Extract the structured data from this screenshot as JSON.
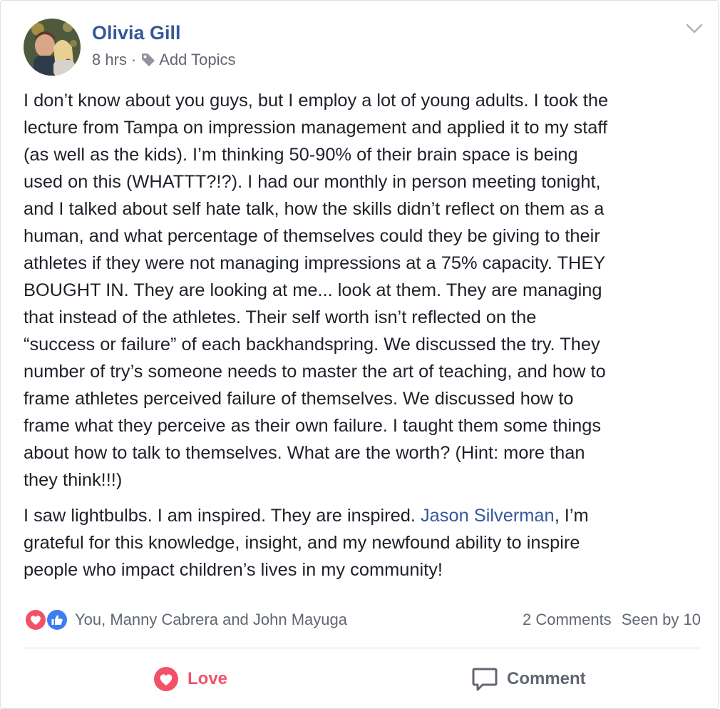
{
  "post": {
    "author": "Olivia Gill",
    "time": "8 hrs",
    "separator": "·",
    "add_topics": "Add Topics",
    "body_lines": [
      "I don’t know about you guys, but I employ a lot of young adults. I took the",
      "lecture from Tampa on impression management and applied it to my staff",
      "(as well as the kids). I’m thinking 50-90% of their brain space is being",
      "used on this (WHATTT?!?). I had our monthly in person meeting tonight,",
      "and I talked about self hate talk, how the skills didn’t reflect on them as a",
      "human, and what percentage of themselves could they be giving to their",
      "athletes if they were not managing impressions at a 75% capacity. THEY",
      "BOUGHT IN. They are looking at me... look at them. They are managing",
      "that instead of the athletes. Their self worth isn’t reflected on the",
      "“success or failure” of each backhandspring. We discussed the try. They",
      "number of try’s someone needs to master the art of teaching, and how to",
      "frame athletes perceived failure of themselves. We discussed how to",
      "frame what they perceive as their own failure. I taught them some things",
      "about how to talk to themselves. What are the worth? (Hint: more than",
      "they think!!!)"
    ],
    "para2_line1_before": "I saw lightbulbs. I am inspired. They are inspired. ",
    "mention": "Jason Silverman",
    "para2_line1_after": ", I’m",
    "para2_line2": "grateful for this knowledge, insight, and my newfound ability to inspire",
    "para2_line3": "people who impact children’s lives in my community!"
  },
  "reactions": {
    "people": "You, Manny Cabrera and John Mayuga",
    "comments": "2 Comments",
    "seen": "Seen by 10",
    "icons": [
      "love-reaction-icon",
      "like-reaction-icon"
    ]
  },
  "actions": {
    "love_label": "Love",
    "comment_label": "Comment"
  },
  "colors": {
    "link": "#365899",
    "love": "#f25268",
    "like": "#3b7df2",
    "text": "#1d2129",
    "muted": "#616770"
  }
}
